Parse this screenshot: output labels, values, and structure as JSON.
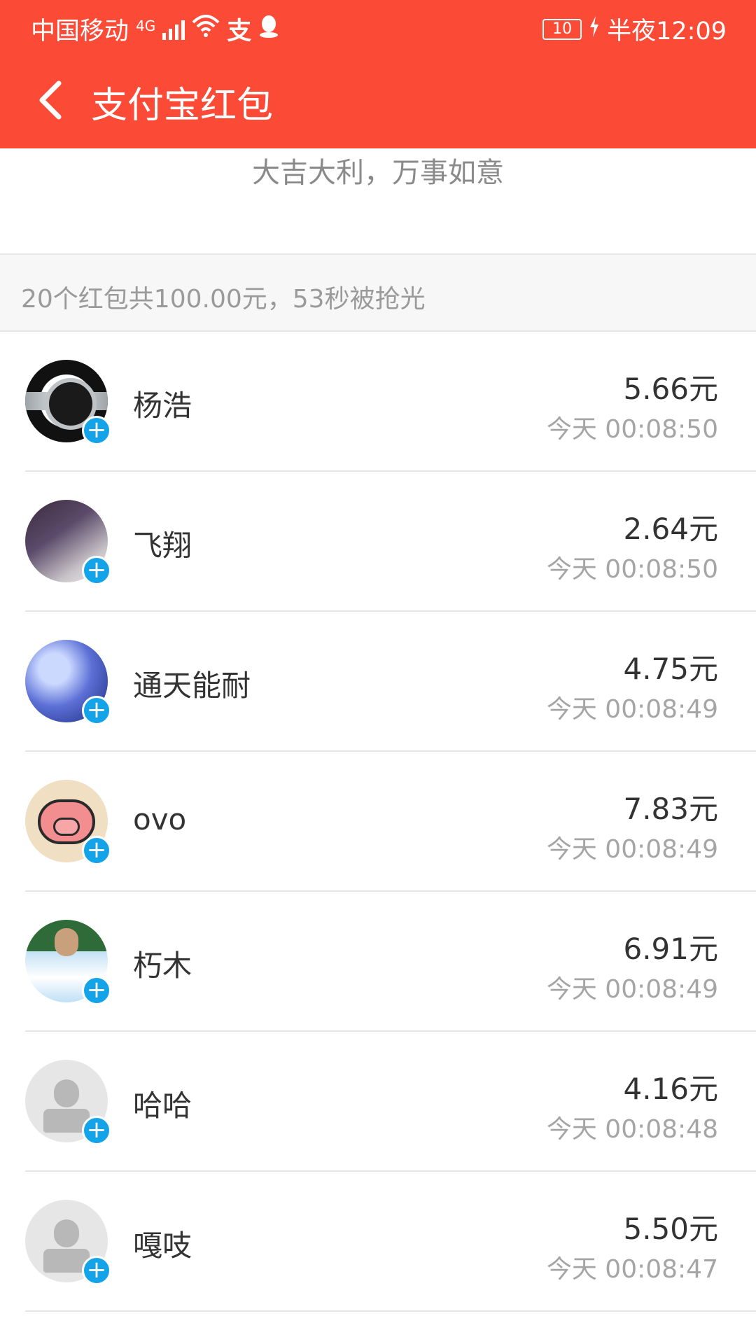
{
  "status_bar": {
    "carrier": "中国移动",
    "network": "4G",
    "battery": "10",
    "time": "半夜12:09"
  },
  "navbar": {
    "title": "支付宝红包",
    "back_icon": "chevron-left-icon"
  },
  "greeting": "大吉大利，万事如意",
  "summary": "20个红包共100.00元，53秒被抢光",
  "records": [
    {
      "name": "杨浩",
      "amount": "5.66元",
      "time": "今天 00:08:50"
    },
    {
      "name": "飞翔",
      "amount": "2.64元",
      "time": "今天 00:08:50"
    },
    {
      "name": "通天能耐",
      "amount": "4.75元",
      "time": "今天 00:08:49"
    },
    {
      "name": "ovo",
      "amount": "7.83元",
      "time": "今天 00:08:49"
    },
    {
      "name": "朽木",
      "amount": "6.91元",
      "time": "今天 00:08:49"
    },
    {
      "name": "哈哈",
      "amount": "4.16元",
      "time": "今天 00:08:48"
    },
    {
      "name": "嘎吱",
      "amount": "5.50元",
      "time": "今天 00:08:47"
    }
  ],
  "colors": {
    "brand_red": "#fb4a35",
    "badge_blue": "#12a3e8"
  }
}
